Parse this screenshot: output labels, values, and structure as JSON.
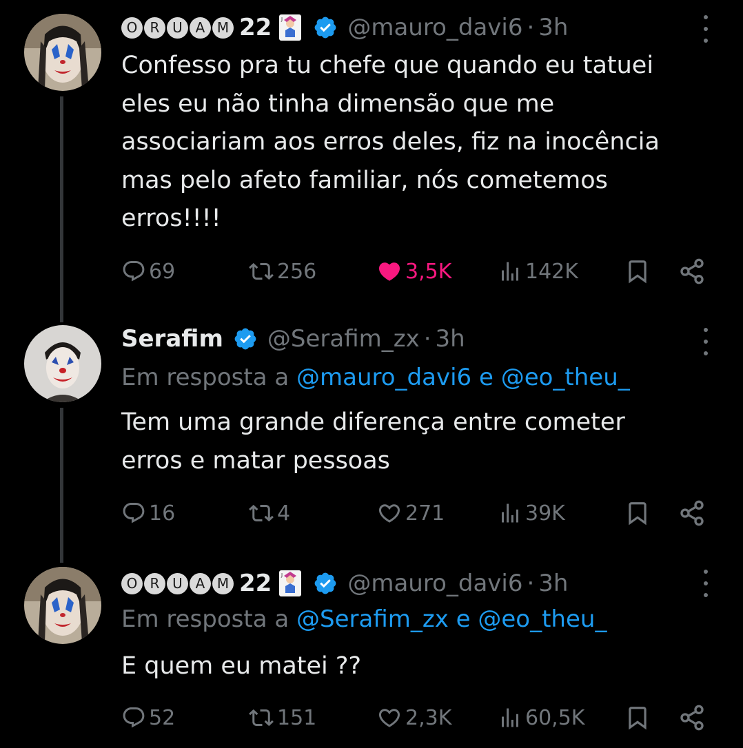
{
  "tweets": [
    {
      "author_badge_letters": [
        "O",
        "R",
        "U",
        "A",
        "M"
      ],
      "author_suffix": "22",
      "handle": "@mauro_davi6",
      "time": "3h",
      "text_lines": [
        "Confesso pra tu chefe que quando eu tatuei",
        "eles eu não tinha dimensão que me",
        "associariam aos erros deles, fiz na inocência",
        "mas pelo afeto familiar, nós cometemos",
        "erros!!!!"
      ],
      "replies": "69",
      "retweets": "256",
      "likes": "3,5K",
      "views": "142K",
      "liked": true
    },
    {
      "name": "Serafim",
      "handle": "@Serafim_zx",
      "time": "3h",
      "reply_prefix": "Em resposta a",
      "reply_mention_1": "@mauro_davi6",
      "reply_conj": "e",
      "reply_mention_2": "@eo_theu_",
      "text_lines": [
        "Tem uma grande diferença entre cometer",
        "erros e matar pessoas"
      ],
      "replies": "16",
      "retweets": "4",
      "likes": "271",
      "views": "39K",
      "liked": false
    },
    {
      "author_badge_letters": [
        "O",
        "R",
        "U",
        "A",
        "M"
      ],
      "author_suffix": "22",
      "handle": "@mauro_davi6",
      "time": "3h",
      "reply_prefix": "Em resposta a",
      "reply_mention_1": "@Serafim_zx",
      "reply_conj": "e",
      "reply_mention_2": "@eo_theu_",
      "text_lines": [
        "E quem eu matei ??"
      ],
      "replies": "52",
      "retweets": "151",
      "likes": "2,3K",
      "views": "60,5K",
      "liked": false
    }
  ],
  "separator": "·",
  "icons": {
    "reply": "reply-icon",
    "retweet": "retweet-icon",
    "like": "heart-icon",
    "views": "views-icon",
    "bookmark": "bookmark-icon",
    "share": "share-icon",
    "verified": "verified-badge-icon",
    "more": "more-icon",
    "card": "joker-card-emoji-icon"
  },
  "colors": {
    "background": "#000000",
    "text": "#e7e9ea",
    "muted": "#71767b",
    "link": "#1d9bf0",
    "like_active": "#f91880",
    "verified": "#1d9bf0"
  }
}
